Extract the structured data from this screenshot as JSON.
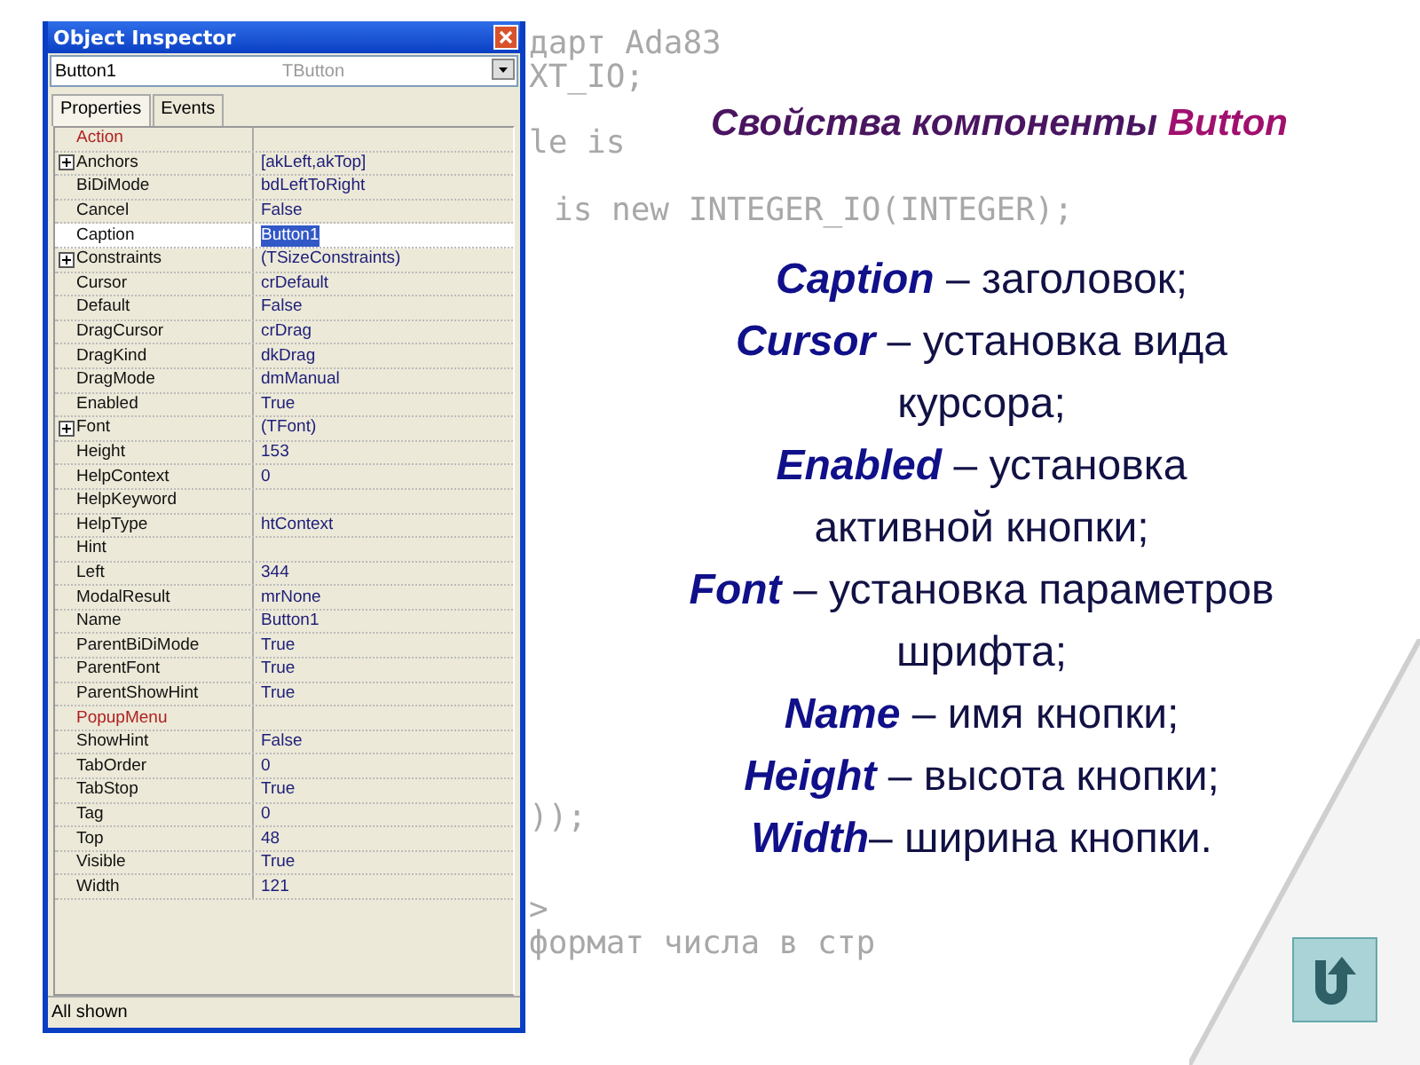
{
  "inspector": {
    "title": "Object Inspector",
    "object": {
      "name": "Button1",
      "type": "TButton"
    },
    "tabs": [
      {
        "label": "Properties",
        "selected": true
      },
      {
        "label": "Events",
        "selected": false
      }
    ],
    "rows": [
      {
        "name": "Action",
        "value": "",
        "kind": "link",
        "selected": false
      },
      {
        "name": "Anchors",
        "value": "[akLeft,akTop]",
        "kind": "expandable",
        "selected": false
      },
      {
        "name": "BiDiMode",
        "value": "bdLeftToRight",
        "kind": "plain",
        "selected": false
      },
      {
        "name": "Cancel",
        "value": "False",
        "kind": "plain",
        "selected": false
      },
      {
        "name": "Caption",
        "value": "Button1",
        "kind": "plain",
        "selected": true
      },
      {
        "name": "Constraints",
        "value": "(TSizeConstraints)",
        "kind": "expandable",
        "selected": false
      },
      {
        "name": "Cursor",
        "value": "crDefault",
        "kind": "plain",
        "selected": false
      },
      {
        "name": "Default",
        "value": "False",
        "kind": "plain",
        "selected": false
      },
      {
        "name": "DragCursor",
        "value": "crDrag",
        "kind": "plain",
        "selected": false
      },
      {
        "name": "DragKind",
        "value": "dkDrag",
        "kind": "plain",
        "selected": false
      },
      {
        "name": "DragMode",
        "value": "dmManual",
        "kind": "plain",
        "selected": false
      },
      {
        "name": "Enabled",
        "value": "True",
        "kind": "plain",
        "selected": false
      },
      {
        "name": "Font",
        "value": "(TFont)",
        "kind": "expandable",
        "selected": false
      },
      {
        "name": "Height",
        "value": "153",
        "kind": "plain",
        "selected": false
      },
      {
        "name": "HelpContext",
        "value": "0",
        "kind": "plain",
        "selected": false
      },
      {
        "name": "HelpKeyword",
        "value": "",
        "kind": "plain",
        "selected": false
      },
      {
        "name": "HelpType",
        "value": "htContext",
        "kind": "plain",
        "selected": false
      },
      {
        "name": "Hint",
        "value": "",
        "kind": "plain",
        "selected": false
      },
      {
        "name": "Left",
        "value": "344",
        "kind": "plain",
        "selected": false
      },
      {
        "name": "ModalResult",
        "value": "mrNone",
        "kind": "plain",
        "selected": false
      },
      {
        "name": "Name",
        "value": "Button1",
        "kind": "plain",
        "selected": false
      },
      {
        "name": "ParentBiDiMode",
        "value": "True",
        "kind": "plain",
        "selected": false
      },
      {
        "name": "ParentFont",
        "value": "True",
        "kind": "plain",
        "selected": false
      },
      {
        "name": "ParentShowHint",
        "value": "True",
        "kind": "plain",
        "selected": false
      },
      {
        "name": "PopupMenu",
        "value": "",
        "kind": "link",
        "selected": false
      },
      {
        "name": "ShowHint",
        "value": "False",
        "kind": "plain",
        "selected": false
      },
      {
        "name": "TabOrder",
        "value": "0",
        "kind": "plain",
        "selected": false
      },
      {
        "name": "TabStop",
        "value": "True",
        "kind": "plain",
        "selected": false
      },
      {
        "name": "Tag",
        "value": "0",
        "kind": "plain",
        "selected": false
      },
      {
        "name": "Top",
        "value": "48",
        "kind": "plain",
        "selected": false
      },
      {
        "name": "Visible",
        "value": "True",
        "kind": "plain",
        "selected": false
      },
      {
        "name": "Width",
        "value": "121",
        "kind": "plain",
        "selected": false
      }
    ],
    "status_bar": "All shown"
  },
  "background_code": [
    "дарт Ada83",
    "XT_IO;",
    "le is",
    "is new INTEGER_IO(INTEGER);",
    "));",
    ">",
    "формат числа в стр"
  ],
  "slide": {
    "title": "Свойства компоненты **Button**",
    "items": [
      {
        "term": "Caption",
        "text": " – заголовок;"
      },
      {
        "term": "Cursor",
        "text": " – установка вида курсора;"
      },
      {
        "term": "Enabled",
        "text": " – установка активной кнопки;"
      },
      {
        "term": "Font",
        "text": " – установка параметров шрифта;"
      },
      {
        "term": "Name",
        "text": " – имя кнопки;"
      },
      {
        "term": "Height",
        "text": " – высота кнопки;"
      },
      {
        "term": "Width",
        "text": "– ширина кнопки."
      }
    ]
  }
}
